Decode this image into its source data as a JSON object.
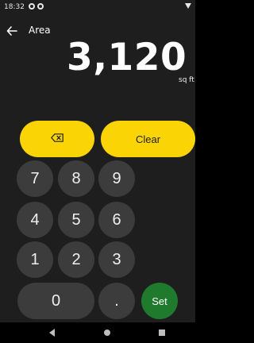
{
  "status_bar": {
    "time": "18:32"
  },
  "header": {
    "title": "Area"
  },
  "display": {
    "value": "3,120",
    "unit": "sq ft"
  },
  "keypad": {
    "clear_label": "Clear",
    "set_label": "Set",
    "digits": [
      "7",
      "8",
      "9",
      "4",
      "5",
      "6",
      "1",
      "2",
      "3"
    ],
    "zero": "0",
    "decimal": "."
  },
  "colors": {
    "accent": "#fbd406",
    "confirm": "#1f7a2e",
    "key": "#3c3c3c",
    "background": "#1e1e1e"
  },
  "icons": {
    "back": "arrow-left-icon",
    "backspace": "backspace-icon"
  }
}
